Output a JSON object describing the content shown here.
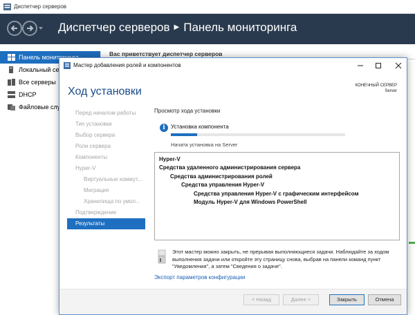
{
  "server_manager": {
    "window_title": "Диспетчер серверов",
    "breadcrumb_app": "Диспетчер серверов",
    "breadcrumb_page": "Панель мониторинга",
    "welcome": "Вас приветствует диспетчер серверов",
    "sidebar": [
      {
        "label": "Панель мониторинга",
        "icon": "dashboard-icon",
        "active": true
      },
      {
        "label": "Локальный сервер",
        "icon": "server-icon"
      },
      {
        "label": "Все серверы",
        "icon": "servers-icon"
      },
      {
        "label": "DHCP",
        "icon": "role-icon"
      },
      {
        "label": "Файловые службы",
        "icon": "file-services-icon"
      }
    ]
  },
  "wizard": {
    "window_title": "Мастер добавления ролей и компонентов",
    "heading": "Ход установки",
    "destination_label": "КОНЕЧНЫЙ СЕРВЕР",
    "destination_value": "Server",
    "steps": [
      {
        "label": "Перед началом работы"
      },
      {
        "label": "Тип установки"
      },
      {
        "label": "Выбор сервера"
      },
      {
        "label": "Роли сервера"
      },
      {
        "label": "Компоненты"
      },
      {
        "label": "Hyper-V"
      },
      {
        "label": "Виртуальные коммут...",
        "sub": true
      },
      {
        "label": "Миграция",
        "sub": true
      },
      {
        "label": "Хранилища по умол...",
        "sub": true
      },
      {
        "label": "Подтверждение"
      },
      {
        "label": "Результаты",
        "active": true
      }
    ],
    "progress_caption": "Просмотр хода установки",
    "progress_title": "Установка компонента",
    "progress_fraction": 0.15,
    "progress_status": "Начата установка на Server",
    "results": [
      {
        "text": "Hyper-V",
        "level": 0
      },
      {
        "text": "Средства удаленного администрирования сервера",
        "level": 0
      },
      {
        "text": "Средства администрирования ролей",
        "level": 1
      },
      {
        "text": "Средства управления Hyper-V",
        "level": 2
      },
      {
        "text": "Средства управления Hyper-V с графическим интерфейсом",
        "level": 3
      },
      {
        "text": "Модуль Hyper-V для Windows PowerShell",
        "level": 3
      }
    ],
    "note": "Этот мастер можно закрыть, не прерывая выполняющиеся задачи. Наблюдайте за ходом выполнения задачи или откройте эту страницу снова, выбрав на панели команд пункт \"Уведомления\", а затем \"Сведения о задаче\".",
    "export_link": "Экспорт параметров конфигурации",
    "buttons": {
      "back": "< Назад",
      "next": "Далее >",
      "install": "Закрыть",
      "cancel": "Отмена"
    }
  },
  "colors": {
    "accent": "#1e6fc0",
    "header_bg": "#2a3a4e",
    "heading": "#1a4b8c"
  }
}
